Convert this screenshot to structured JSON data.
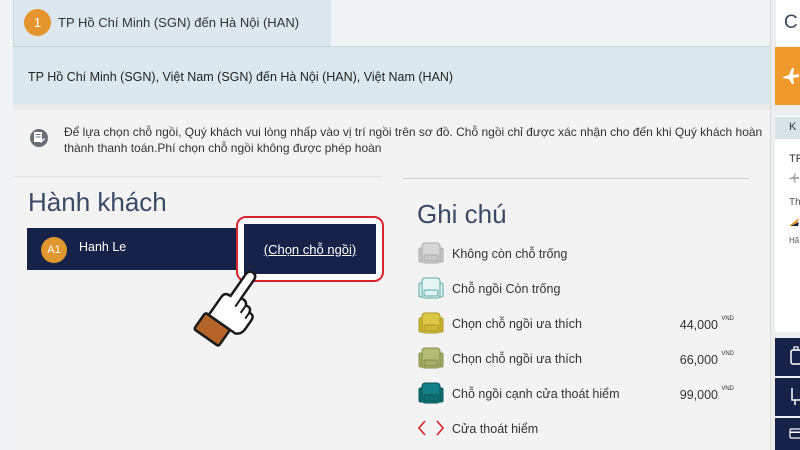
{
  "flight": {
    "step": "1",
    "title": "TP Hồ Chí Minh (SGN) đến Hà Nội (HAN)",
    "route": "TP Hồ Chí Minh (SGN), Việt Nam (SGN) đến Hà Nội (HAN), Việt Nam (HAN)"
  },
  "notice": "Để lựa chọn chỗ ngồi, Quý khách vui lòng nhấp vào vị trí ngồi trên sơ đồ. Chỗ ngồi chỉ được xác nhận cho đến khi Quý khách hoàn thành thanh toán.Phí chọn chỗ ngồi không được phép hoàn",
  "passengers": {
    "title": "Hành khách",
    "list": [
      {
        "seat_code": "A1",
        "name": "Hanh Le",
        "action_label": "(Chọn chỗ ngồi)"
      }
    ]
  },
  "legend": {
    "title": "Ghi chú",
    "items": [
      {
        "icon": "seat-unavailable-icon",
        "color": "#c8c8c8",
        "label": "Không còn chỗ trống",
        "price": "",
        "currency": ""
      },
      {
        "icon": "seat-available-icon",
        "color": "#6fb6b3",
        "label": "Chỗ ngồi Còn trống",
        "price": "",
        "currency": ""
      },
      {
        "icon": "seat-preferred-icon",
        "color": "#d8c33a",
        "label": "Chọn chỗ ngồi ưa thích",
        "price": "44,000",
        "currency": "VND"
      },
      {
        "icon": "seat-preferred-plus-icon",
        "color": "#a9b36a",
        "label": "Chọn chỗ ngồi ưa thích",
        "price": "66,000",
        "currency": "VND"
      },
      {
        "icon": "seat-exit-row-icon",
        "color": "#0f7a7d",
        "label": "Chỗ ngồi cạnh cửa thoát hiểm",
        "price": "99,000",
        "currency": "VND"
      },
      {
        "icon": "emergency-exit-icon",
        "color": "#d9242e",
        "label": "Cửa thoát hiểm",
        "price": "",
        "currency": ""
      }
    ]
  },
  "sidebar": {
    "heading_partial": "C",
    "tab_partial": "K",
    "from_partial": "TP",
    "date_partial": "Th",
    "airline_partial": "Hã"
  },
  "colors": {
    "navy": "#172249",
    "orange": "#e5952e",
    "highlight_red": "#d9242e"
  }
}
